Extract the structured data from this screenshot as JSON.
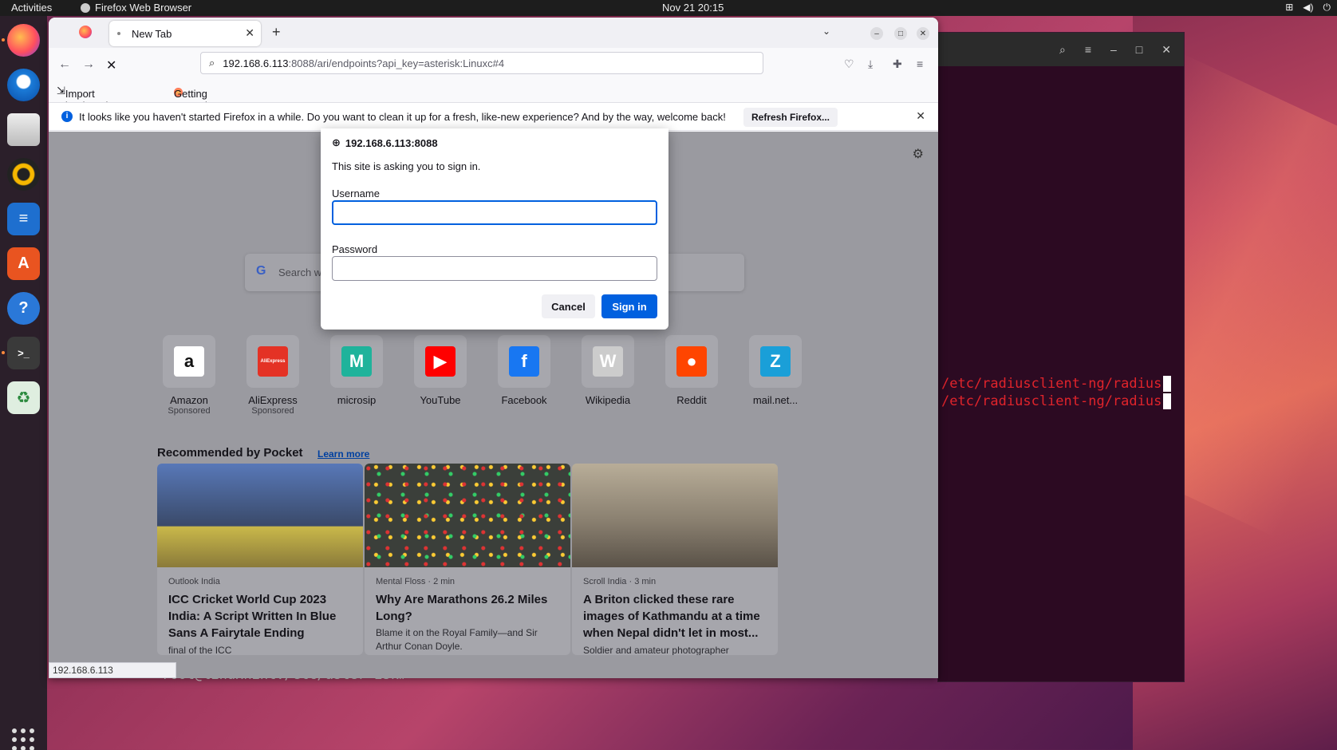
{
  "topbar": {
    "activities": "Activities",
    "app_name": "Firefox Web Browser",
    "clock": "Nov 21  20:15"
  },
  "dock": {
    "items": [
      "firefox-icon",
      "thunderbird-icon",
      "files-icon",
      "rhythmbox-icon",
      "writer-icon",
      "app-center-icon",
      "help-icon",
      "terminal-icon",
      "trash-icon"
    ]
  },
  "terminal": {
    "lines": [
      "/etc/radiusclient-ng/radius",
      "/etc/radiusclient-ng/radius"
    ],
    "bottom_line": "root@linuxhint:/etc/aster isk# "
  },
  "browser": {
    "tab_title": "New Tab",
    "url_host": "192.168.6.113",
    "url_rest": ":8088/ari/endpoints?api_key=asterisk:Linuxc#4",
    "bookmarks": [
      "Import bookmarks...",
      "Getting Started"
    ],
    "notice": {
      "message": "It looks like you haven't started Firefox in a while. Do you want to clean it up for a fresh, like-new experience? And by the way, welcome back!",
      "button": "Refresh Firefox..."
    },
    "search_placeholder": "Search w",
    "top_sites": [
      {
        "label": "Amazon",
        "sponsored": "Sponsored",
        "color": "#ffffff",
        "glyph": "a"
      },
      {
        "label": "AliExpress",
        "sponsored": "Sponsored",
        "color": "#e43225",
        "glyph": "AliExpress"
      },
      {
        "label": "microsip",
        "sponsored": "",
        "color": "#1fb39b",
        "glyph": "M"
      },
      {
        "label": "YouTube",
        "sponsored": "",
        "color": "#ff0000",
        "glyph": "▶"
      },
      {
        "label": "Facebook",
        "sponsored": "",
        "color": "#1877f2",
        "glyph": "f"
      },
      {
        "label": "Wikipedia",
        "sponsored": "",
        "color": "#cccccc",
        "glyph": "W"
      },
      {
        "label": "Reddit",
        "sponsored": "",
        "color": "#ff4500",
        "glyph": "●"
      },
      {
        "label": "mail.net...",
        "sponsored": "",
        "color": "#1a9fd8",
        "glyph": "Z"
      }
    ],
    "pocket": {
      "heading": "Recommended by Pocket",
      "learn_more": "Learn more",
      "cards": [
        {
          "source": "Outlook India",
          "title": "ICC Cricket World Cup 2023 India: A Script Written In Blue Sans A Fairytale Ending",
          "excerpt": "final of the ICC",
          "img_color": "#5a6a8a"
        },
        {
          "source": "Mental Floss · 2 min",
          "title": "Why Are Marathons 26.2 Miles Long?",
          "excerpt": "Blame it on the Royal Family—and Sir Arthur Conan Doyle.",
          "img_color": "#3b3f3a"
        },
        {
          "source": "Scroll India · 3 min",
          "title": "A Briton clicked these rare images of Kathmandu at a time when Nepal didn't let in most...",
          "excerpt": "Soldier and amateur photographer",
          "img_color": "#8a8070"
        }
      ]
    },
    "status_url": "192.168.6.113"
  },
  "dialog": {
    "host": "192.168.6.113:8088",
    "subtitle": "This site is asking you to sign in.",
    "username_label": "Username",
    "username_value": "",
    "password_label": "Password",
    "password_value": "",
    "cancel": "Cancel",
    "sign_in": "Sign in"
  }
}
